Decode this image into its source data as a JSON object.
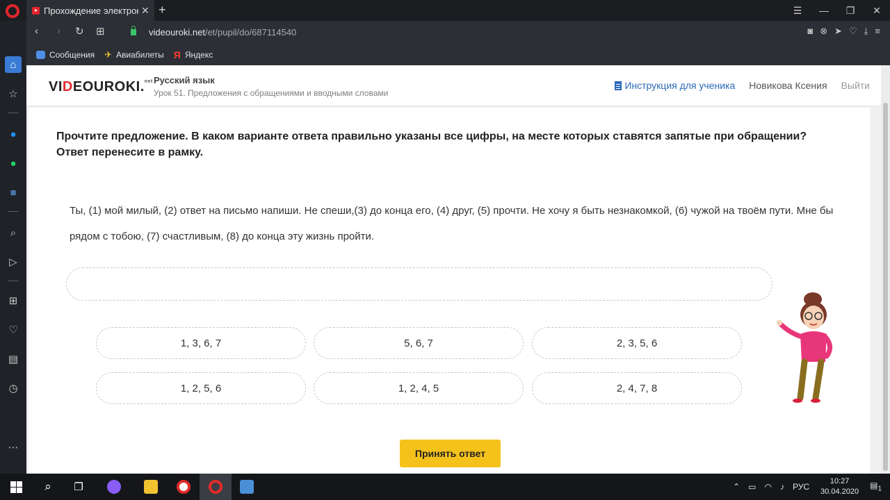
{
  "browser": {
    "tab_title": "Прохождение электронного",
    "tab_close": "✕",
    "new_tab": "+",
    "url_host": "videouroki.net",
    "url_path": "/et/pupil/do/687114540",
    "bookmarks": [
      {
        "label": "Сообщения"
      },
      {
        "label": "Авиабилеты"
      },
      {
        "label": "Яндекс"
      }
    ]
  },
  "site": {
    "logo_left": "VI",
    "logo_red": "D",
    "logo_right": "EOUROKI.",
    "logo_sup": "net",
    "course_title": "Русский язык",
    "course_subtitle": "Урок 51. Предложения с обращениями и вводными словами",
    "instruction_link": "Инструкция для ученика",
    "user_name": "Новикова Ксения",
    "logout": "Выйти"
  },
  "task": {
    "question": "Прочтите предложение. В каком варианте ответа правильно указаны все цифры, на месте которых ставятся запятые при обращении? Ответ перенесите в рамку.",
    "sentence": "Ты, (1) мой милый, (2) ответ на письмо напиши. Не спеши,(3) до конца его, (4) друг, (5) прочти. Не хочу я быть незнакомкой, (6) чужой на твоём пути. Мне бы рядом с тобою, (7) счастливым, (8) до конца эту жизнь пройти.",
    "options": [
      "1, 3, 6, 7",
      "5, 6, 7",
      "2, 3, 5, 6",
      "1, 2, 5, 6",
      "1, 2, 4, 5",
      "2, 4, 7, 8"
    ],
    "submit_label": "Принять ответ"
  },
  "taskbar": {
    "language": "РУС",
    "time": "10:27",
    "date": "30.04.2020",
    "notifications": "1"
  }
}
